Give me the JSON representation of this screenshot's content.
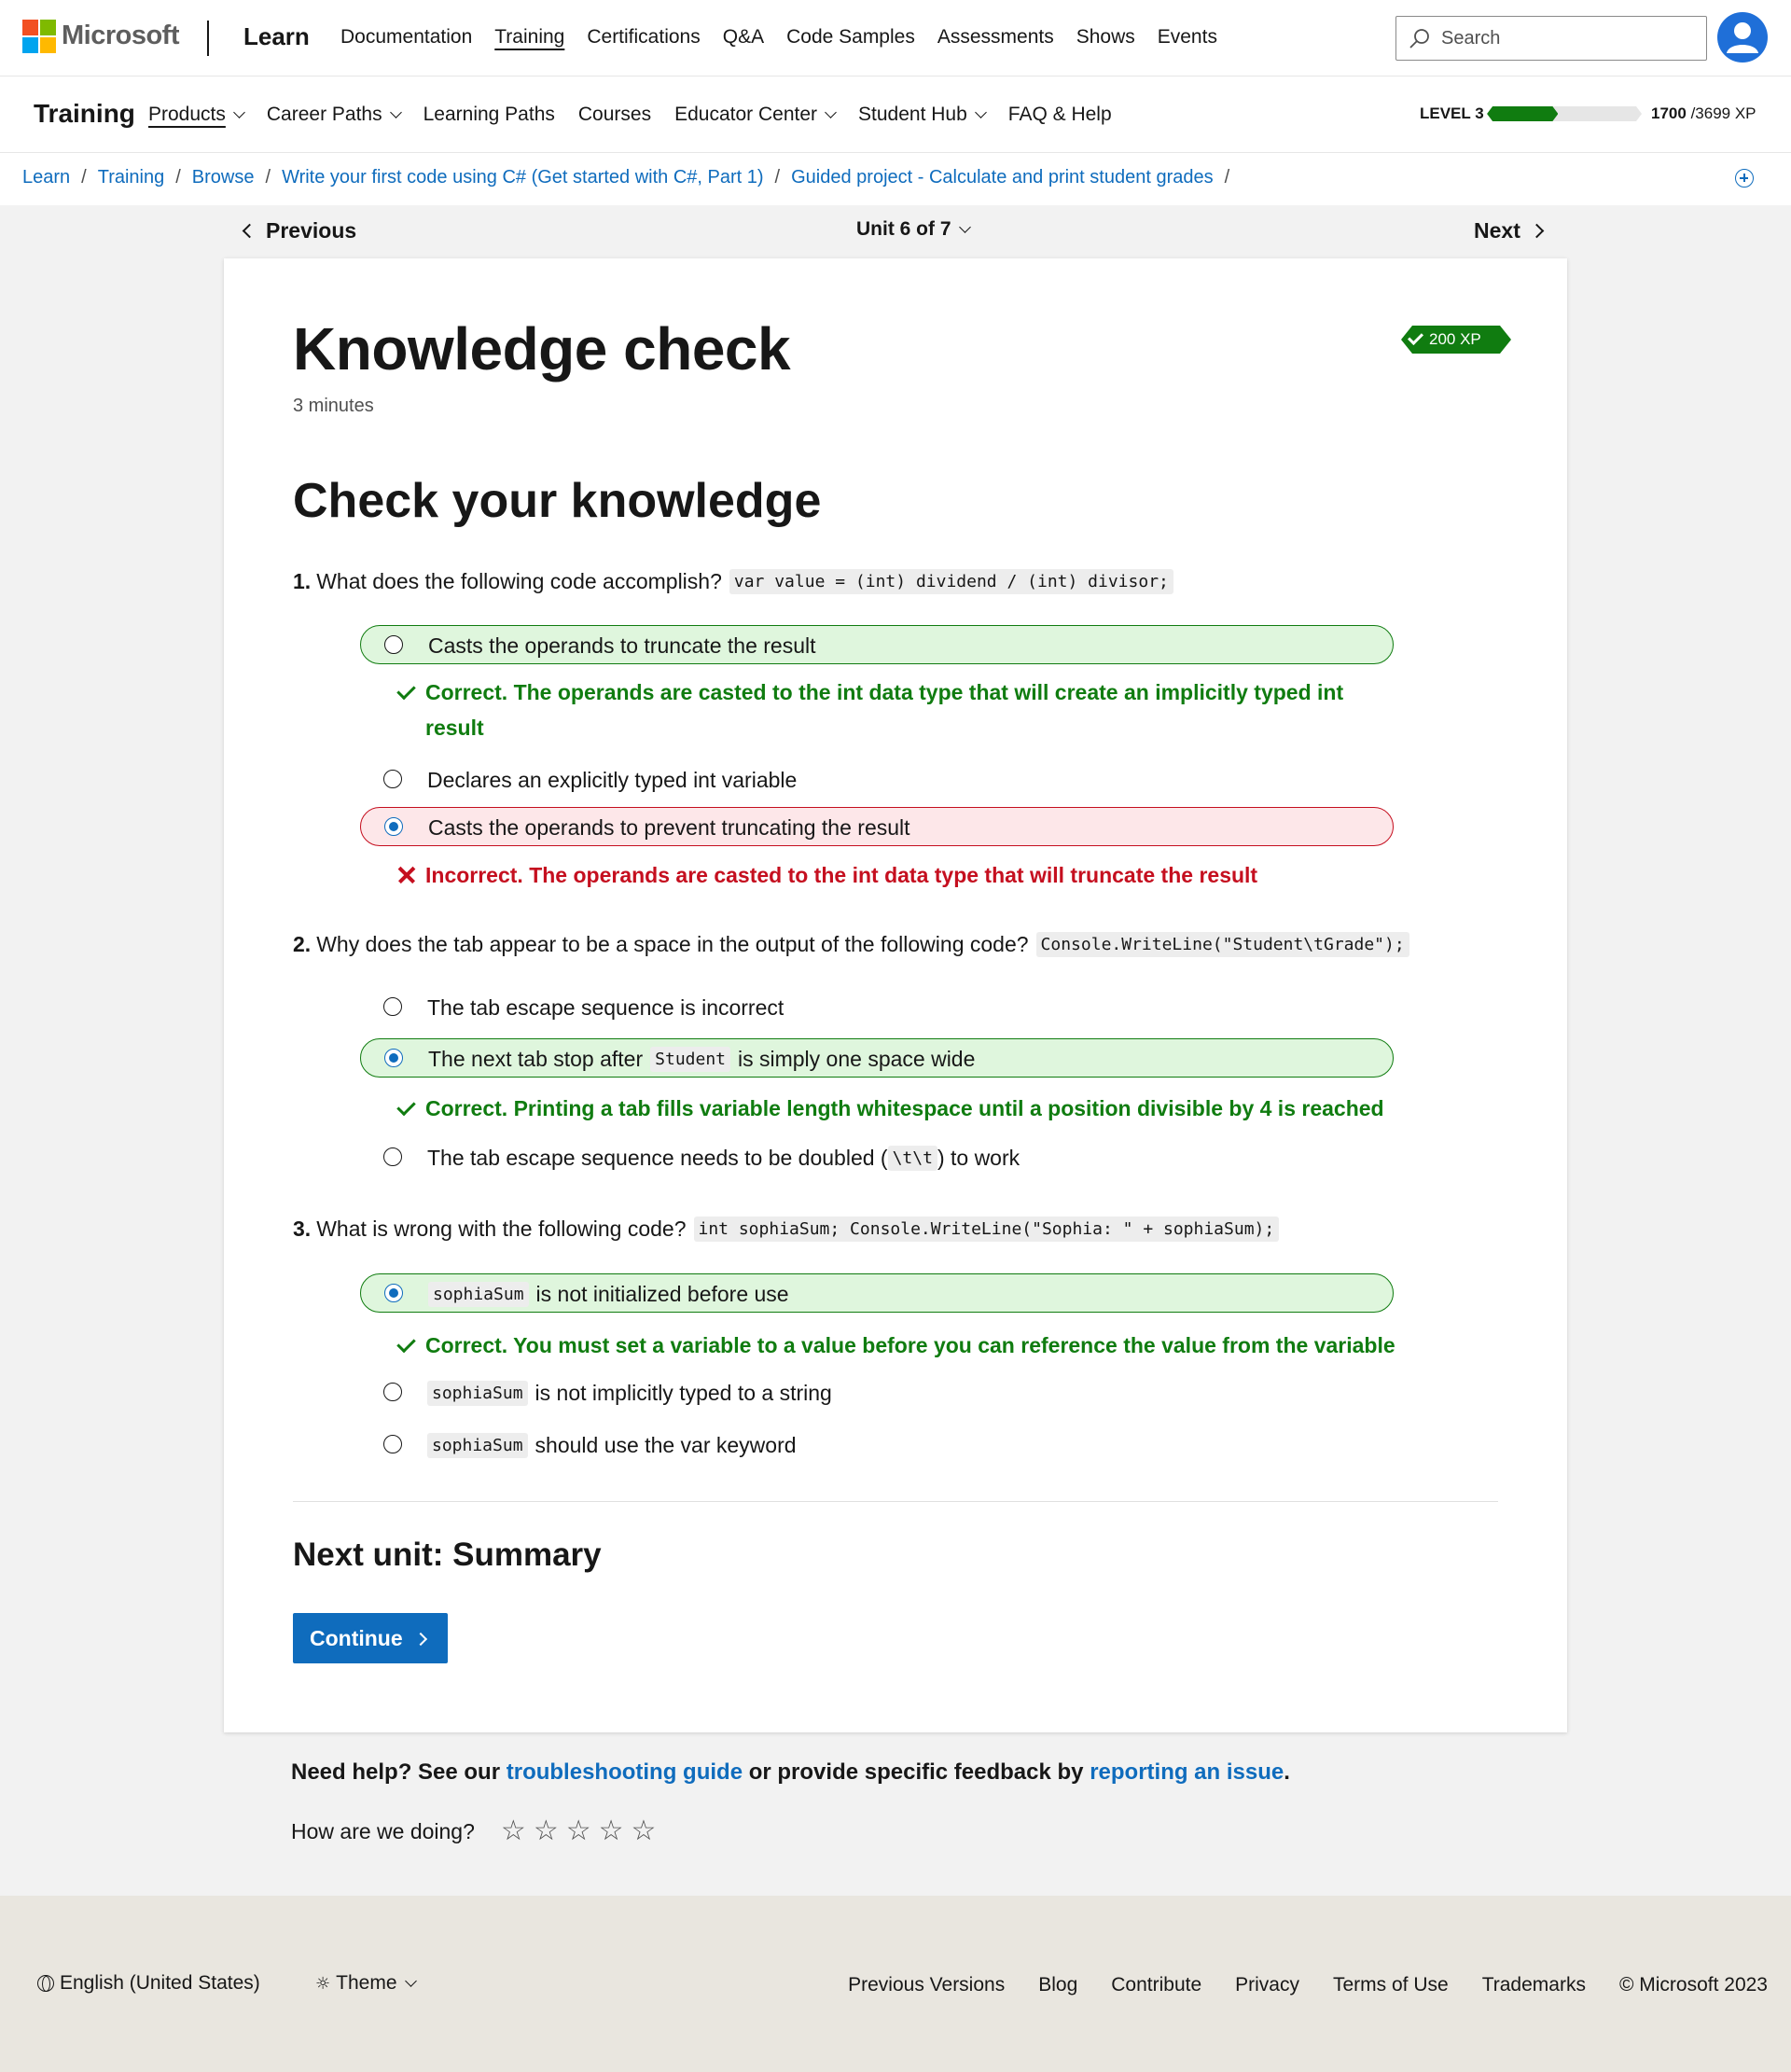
{
  "header": {
    "brand": "Microsoft",
    "product": "Learn",
    "nav": [
      "Documentation",
      "Training",
      "Certifications",
      "Q&A",
      "Code Samples",
      "Assessments",
      "Shows",
      "Events"
    ],
    "active_nav": "Training",
    "search_placeholder": "Search"
  },
  "training_bar": {
    "title": "Training",
    "items": [
      "Products",
      "Career Paths",
      "Learning Paths",
      "Courses",
      "Educator Center",
      "Student Hub",
      "FAQ & Help"
    ],
    "level_label": "LEVEL 3",
    "xp_current": "1700",
    "xp_total": "/3699 XP",
    "xp_progress_fraction": 0.46
  },
  "breadcrumb": [
    "Learn",
    "Training",
    "Browse",
    "Write your first code using C# (Get started with C#, Part 1)",
    "Guided project - Calculate and print student grades"
  ],
  "unit_nav": {
    "previous": "Previous",
    "unit": "Unit 6 of 7",
    "next": "Next"
  },
  "page": {
    "title": "Knowledge check",
    "duration": "3 minutes",
    "xp_badge": "200 XP",
    "section_title": "Check your knowledge"
  },
  "questions": [
    {
      "num": "1.",
      "text": "What does the following code accomplish?",
      "code": "var value = (int) dividend / (int) divisor;",
      "options": [
        {
          "text": "Casts the operands to truncate the result",
          "state": "correct",
          "selected": false
        },
        {
          "text": "Declares an explicitly typed int variable",
          "state": "none",
          "selected": false
        },
        {
          "text": "Casts the operands to prevent truncating the result",
          "state": "incorrect",
          "selected": true
        }
      ],
      "feedback": [
        {
          "type": "correct",
          "text": "Correct. The operands are casted to the int data type that will create an implicitly typed int result"
        },
        {
          "type": "incorrect",
          "text": "Incorrect. The operands are casted to the int data type that will truncate the result"
        }
      ]
    },
    {
      "num": "2.",
      "text": "Why does the tab appear to be a space in the output of the following code?",
      "code": "Console.WriteLine(\"Student\\tGrade\");",
      "options": [
        {
          "text": "The tab escape sequence is incorrect",
          "state": "none",
          "selected": false
        },
        {
          "pre": "The next tab stop after",
          "code": "Student",
          "post": "is simply one space wide",
          "state": "correct",
          "selected": true
        },
        {
          "pre": "The tab escape sequence needs to be doubled (",
          "code": "\\t\\t",
          "post": ") to work",
          "state": "none",
          "selected": false
        }
      ],
      "feedback": [
        {
          "type": "correct",
          "text": "Correct. Printing a tab fills variable length whitespace until a position divisible by 4 is reached"
        }
      ]
    },
    {
      "num": "3.",
      "text": "What is wrong with the following code?",
      "code": "int sophiaSum; Console.WriteLine(\"Sophia: \" + sophiaSum);",
      "options": [
        {
          "code": "sophiaSum",
          "post": "is not initialized before use",
          "state": "correct",
          "selected": true
        },
        {
          "code": "sophiaSum",
          "post": "is not implicitly typed to a string",
          "state": "none",
          "selected": false
        },
        {
          "code": "sophiaSum",
          "post": "should use the var keyword",
          "state": "none",
          "selected": false
        }
      ],
      "feedback": [
        {
          "type": "correct",
          "text": "Correct. You must set a variable to a value before you can reference the value from the variable"
        }
      ]
    }
  ],
  "next_unit": {
    "label": "Next unit: Summary",
    "button": "Continue"
  },
  "help": {
    "prefix": "Need help? See our",
    "link1": "troubleshooting guide",
    "middle": "or provide specific feedback by",
    "link2": "reporting an issue",
    "suffix": "."
  },
  "rating": {
    "label": "How are we doing?",
    "stars": 5
  },
  "footer": {
    "language": "English (United States)",
    "theme": "Theme",
    "links": [
      "Previous Versions",
      "Blog",
      "Contribute",
      "Privacy",
      "Terms of Use",
      "Trademarks",
      "© Microsoft 2023"
    ]
  },
  "colors": {
    "accent": "#0f6cbd",
    "success": "#107c10",
    "danger": "#c50f1f"
  },
  "icons": [
    "microsoft-logo",
    "search-icon",
    "avatar",
    "chevron-down-icon",
    "chevron-left-icon",
    "chevron-right-icon",
    "check-icon",
    "x-icon",
    "star-icon",
    "globe-icon",
    "sun-icon",
    "add-circle-icon"
  ]
}
